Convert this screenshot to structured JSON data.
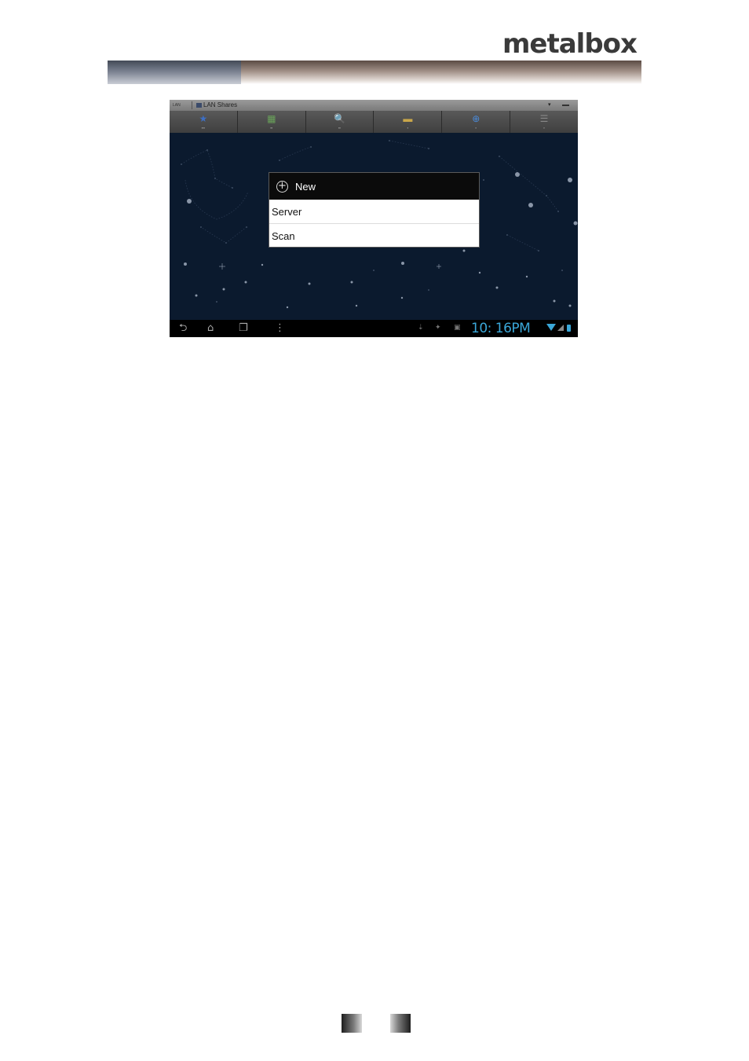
{
  "brand": {
    "name": "metalbox"
  },
  "screen": {
    "titlebar": {
      "location_mini": "LAN",
      "breadcrumb": "LAN Shares",
      "dropdown": "▾"
    },
    "toolbar": [
      {
        "icon": "star-icon",
        "glyph": "★",
        "color": "#3d6fc4"
      },
      {
        "icon": "grid-icon",
        "glyph": "▦",
        "color": "#6aa35a"
      },
      {
        "icon": "search-icon",
        "glyph": "🔍",
        "color": "#6f8fc8"
      },
      {
        "icon": "folder-icon",
        "glyph": "▬",
        "color": "#c9a64a"
      },
      {
        "icon": "new-icon",
        "glyph": "⊕",
        "color": "#4a8ad8"
      },
      {
        "icon": "list-icon",
        "glyph": "☰",
        "color": "#888888"
      }
    ],
    "menu": {
      "title": "New",
      "items": [
        "Server",
        "Scan"
      ]
    },
    "statusbar": {
      "clock": "10: 16PM"
    }
  }
}
